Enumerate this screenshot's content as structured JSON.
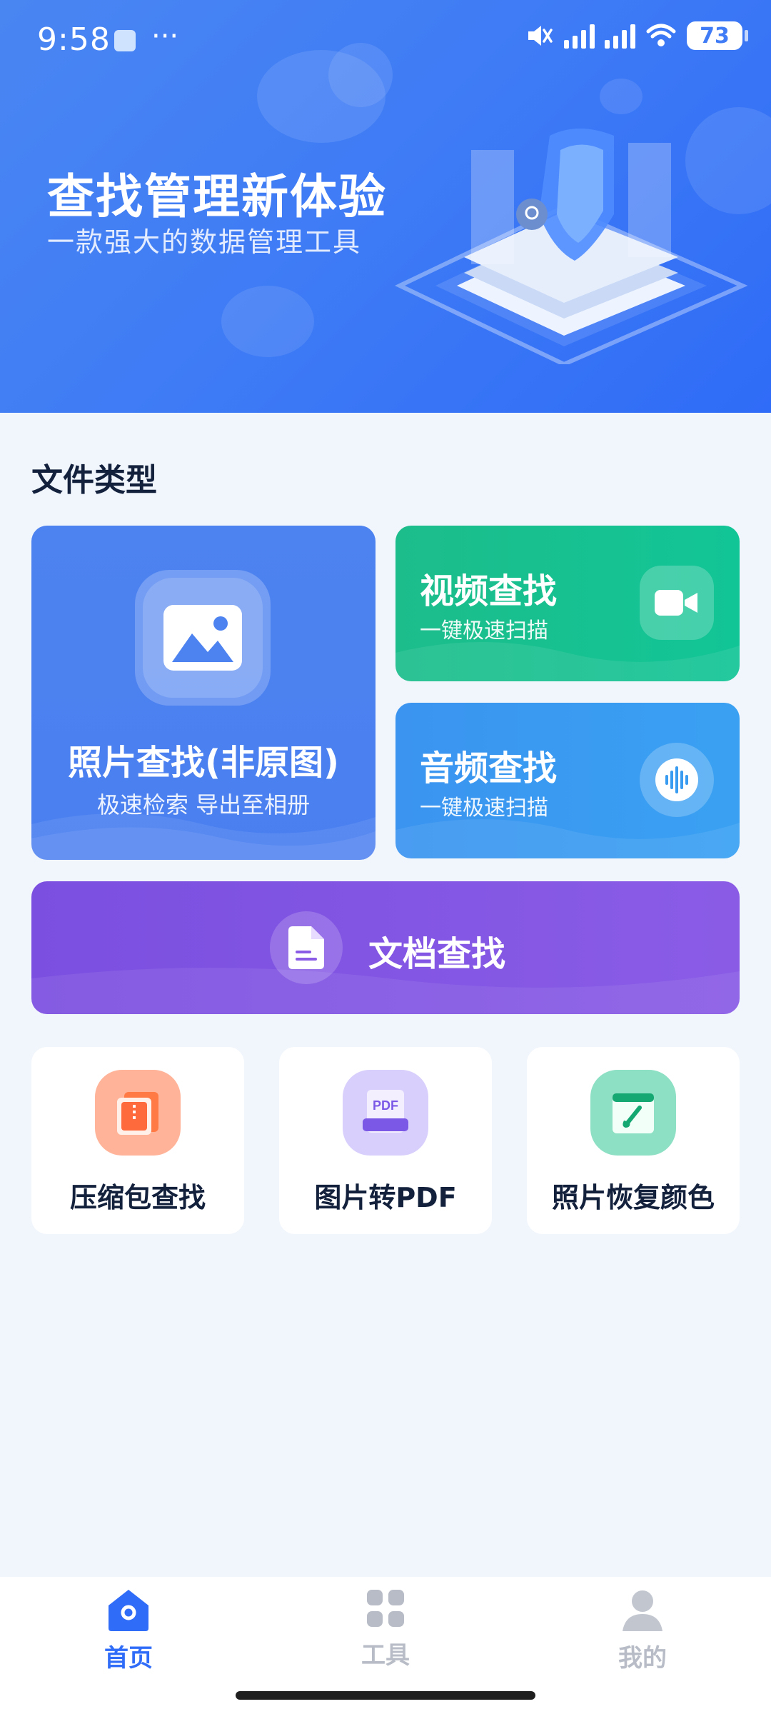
{
  "status_bar": {
    "time": "9:58",
    "dots": "···",
    "battery": "73"
  },
  "hero": {
    "title": "查找管理新体验",
    "subtitle": "一款强大的数据管理工具"
  },
  "section": {
    "title": "文件类型"
  },
  "cards": {
    "photo": {
      "title": "照片查找(非原图)",
      "subtitle": "极速检索 导出至相册",
      "icon": "image-icon"
    },
    "video": {
      "title": "视频查找",
      "subtitle": "一键极速扫描",
      "icon": "video-camera-icon"
    },
    "audio": {
      "title": "音频查找",
      "subtitle": "一键极速扫描",
      "icon": "audio-wave-icon"
    },
    "document": {
      "title": "文档查找",
      "icon": "document-icon"
    }
  },
  "tools": [
    {
      "label": "压缩包查找",
      "icon": "zip-icon",
      "icon_bg": "#ffb49a"
    },
    {
      "label": "图片转PDF",
      "icon": "pdf-icon",
      "icon_text": "PDF",
      "icon_bg": "#d9cffc"
    },
    {
      "label": "照片恢复颜色",
      "icon": "paint-brush-icon",
      "icon_bg": "#8de0c3"
    }
  ],
  "bottom_nav": {
    "items": [
      {
        "label": "首页",
        "icon": "home-icon",
        "active": true,
        "color": "#2f6cf7"
      },
      {
        "label": "工具",
        "icon": "grid-icon",
        "active": false,
        "color": "#b7bcc6"
      },
      {
        "label": "我的",
        "icon": "user-icon",
        "active": false,
        "color": "#b7bcc6"
      }
    ]
  },
  "colors": {
    "primary": "#3f7cf5",
    "video": "#12c596",
    "audio": "#3aa1f2",
    "document": "#8a5ce6",
    "background": "#f1f5fc"
  }
}
